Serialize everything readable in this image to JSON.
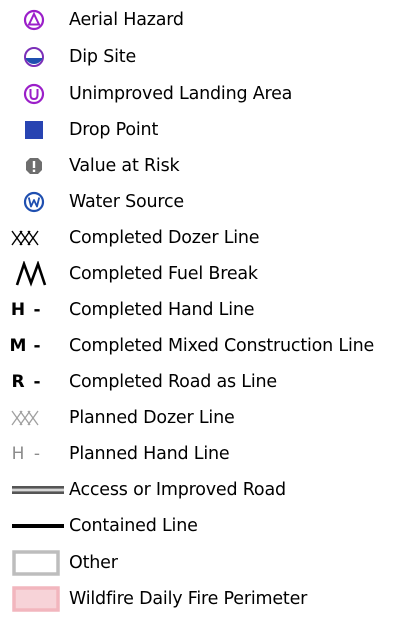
{
  "legend": {
    "items": [
      {
        "label": "Aerial Hazard",
        "icon": "aerial-hazard-icon",
        "color": "#9b1fc9"
      },
      {
        "label": "Dip Site",
        "icon": "dip-site-icon",
        "color": "#1f4fb0"
      },
      {
        "label": "Unimproved Landing Area",
        "icon": "unimproved-landing-area-icon",
        "color": "#9b1fc9"
      },
      {
        "label": "Drop Point",
        "icon": "drop-point-icon",
        "color": "#2844b2"
      },
      {
        "label": "Value at Risk",
        "icon": "value-at-risk-icon",
        "color": "#6e6e6e"
      },
      {
        "label": "Water Source",
        "icon": "water-source-icon",
        "color": "#1f4fb0"
      },
      {
        "label": "Completed Dozer Line",
        "icon": "completed-dozer-line-icon",
        "color": "#000000"
      },
      {
        "label": "Completed Fuel Break",
        "icon": "completed-fuel-break-icon",
        "color": "#000000"
      },
      {
        "label": "Completed Hand Line",
        "icon": "completed-hand-line-icon",
        "symbol_letter": "H",
        "symbol_dash": "-"
      },
      {
        "label": "Completed Mixed Construction Line",
        "icon": "completed-mixed-construction-line-icon",
        "symbol_letter": "M",
        "symbol_dash": "-"
      },
      {
        "label": "Completed Road as Line",
        "icon": "completed-road-as-line-icon",
        "symbol_letter": "R",
        "symbol_dash": "-"
      },
      {
        "label": "Planned Dozer Line",
        "icon": "planned-dozer-line-icon",
        "color": "#a0a0a0"
      },
      {
        "label": "Planned Hand Line",
        "icon": "planned-hand-line-icon",
        "symbol_letter": "H",
        "symbol_dash": "-"
      },
      {
        "label": "Access or Improved Road",
        "icon": "access-or-improved-road-icon",
        "color": "#555555"
      },
      {
        "label": "Contained Line",
        "icon": "contained-line-icon",
        "color": "#000000"
      },
      {
        "label": "Other",
        "icon": "other-icon",
        "color": "#bdbdbd"
      },
      {
        "label": "Wildfire Daily Fire Perimeter",
        "icon": "wildfire-daily-fire-perimeter-icon",
        "color": "#f2b6be"
      }
    ]
  }
}
